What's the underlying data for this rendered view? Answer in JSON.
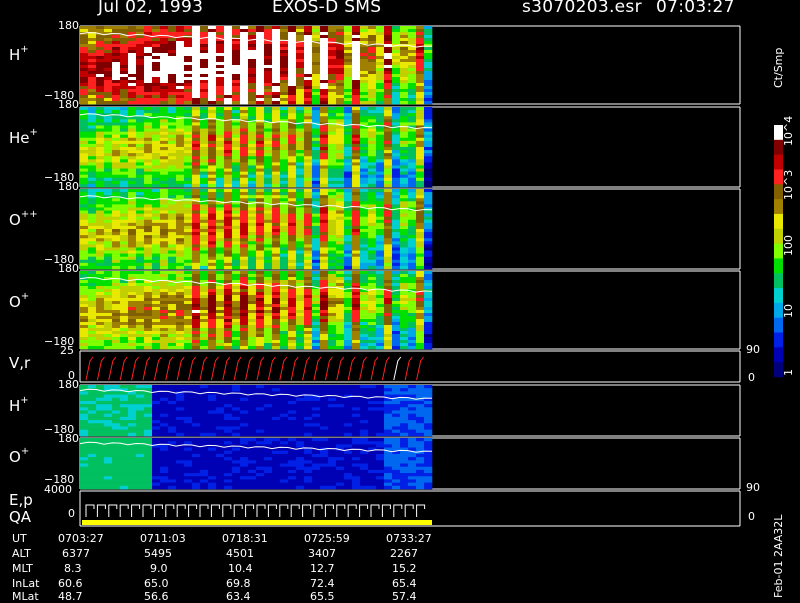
{
  "header": {
    "date": "Jul 02, 1993",
    "instrument": "EXOS-D SMS",
    "file": "s3070203.esr",
    "time": "07:03:27"
  },
  "colors": {
    "background": "#000000",
    "foreground": "#ffffff",
    "trace": "#ffffff",
    "pitch_trace": "#ff2020",
    "qa_bar": "#ffff00"
  },
  "colorbar": {
    "unit": "Ct/Smp",
    "labels": [
      "1",
      "10",
      "100",
      "10^3",
      "10^4"
    ],
    "scale": "log",
    "range": [
      1,
      10000
    ],
    "palette": [
      "#00007a",
      "#0000b4",
      "#0020e6",
      "#0068f0",
      "#00a8e8",
      "#00d0d0",
      "#00c060",
      "#00e000",
      "#80ff00",
      "#c0d000",
      "#e8e800",
      "#a08000",
      "#806000",
      "#ff2020",
      "#c00000",
      "#800000",
      "#ffffff"
    ]
  },
  "axis_ticks": {
    "pitch_top": "180",
    "pitch_bottom": "−180",
    "vr_top": "25",
    "vr_zero": "0",
    "ep_top": "4000",
    "ep_zero": "0",
    "right_90": "90",
    "right_0": "0"
  },
  "panels": [
    {
      "label": "H",
      "sup": "+",
      "kind": "full",
      "intensity": 0.72
    },
    {
      "label": "He",
      "sup": "+",
      "kind": "full",
      "intensity": 0.34
    },
    {
      "label": "O",
      "sup": "++",
      "kind": "full",
      "intensity": 0.38
    },
    {
      "label": "O",
      "sup": "+",
      "kind": "full",
      "intensity": 0.44
    },
    {
      "label": "V,r",
      "sup": "",
      "kind": "vr"
    },
    {
      "label": "H",
      "sup": "+",
      "kind": "low",
      "intensity": 0.28
    },
    {
      "label": "O",
      "sup": "+",
      "kind": "low",
      "intensity": 0.3
    },
    {
      "label": "E,p",
      "sup": "",
      "kind": "ep"
    }
  ],
  "qa_label": "QA",
  "ephemeris": {
    "rows": [
      {
        "label": "UT",
        "values": [
          "0703:27",
          "0711:03",
          "0718:31",
          "0725:59",
          "0733:27"
        ]
      },
      {
        "label": "ALT",
        "values": [
          "6377",
          "5495",
          "4501",
          "3407",
          "2267"
        ]
      },
      {
        "label": "MLT",
        "values": [
          "8.3",
          "9.0",
          "10.4",
          "12.7",
          "15.2"
        ]
      },
      {
        "label": "InLat",
        "values": [
          "60.6",
          "65.0",
          "69.8",
          "72.4",
          "65.4"
        ]
      },
      {
        "label": "MLat",
        "values": [
          "48.7",
          "56.6",
          "63.4",
          "65.5",
          "57.4"
        ]
      }
    ]
  },
  "footer_vertical": "Feb-01  2AA32L",
  "chart_data": {
    "type": "heatmap",
    "title": "Jul 02, 1993   EXOS-D SMS",
    "subtitle": "s3070203.esr  07:03:27",
    "x": [
      "0703:27",
      "0711:03",
      "0718:31",
      "0725:59",
      "0733:27"
    ],
    "series": [
      {
        "name": "H+",
        "values": []
      },
      {
        "name": "He+",
        "values": []
      },
      {
        "name": "O++",
        "values": []
      },
      {
        "name": "O+",
        "values": []
      },
      {
        "name": "V,r",
        "values": []
      },
      {
        "name": "H+",
        "values": []
      },
      {
        "name": "O+",
        "values": []
      },
      {
        "name": "E,p",
        "values": []
      }
    ],
    "ylim": [
      -180,
      180
    ],
    "colorscale": {
      "unit": "Ct/Smp",
      "range": [
        1,
        10000
      ],
      "scale": "log"
    },
    "grid": false
  }
}
